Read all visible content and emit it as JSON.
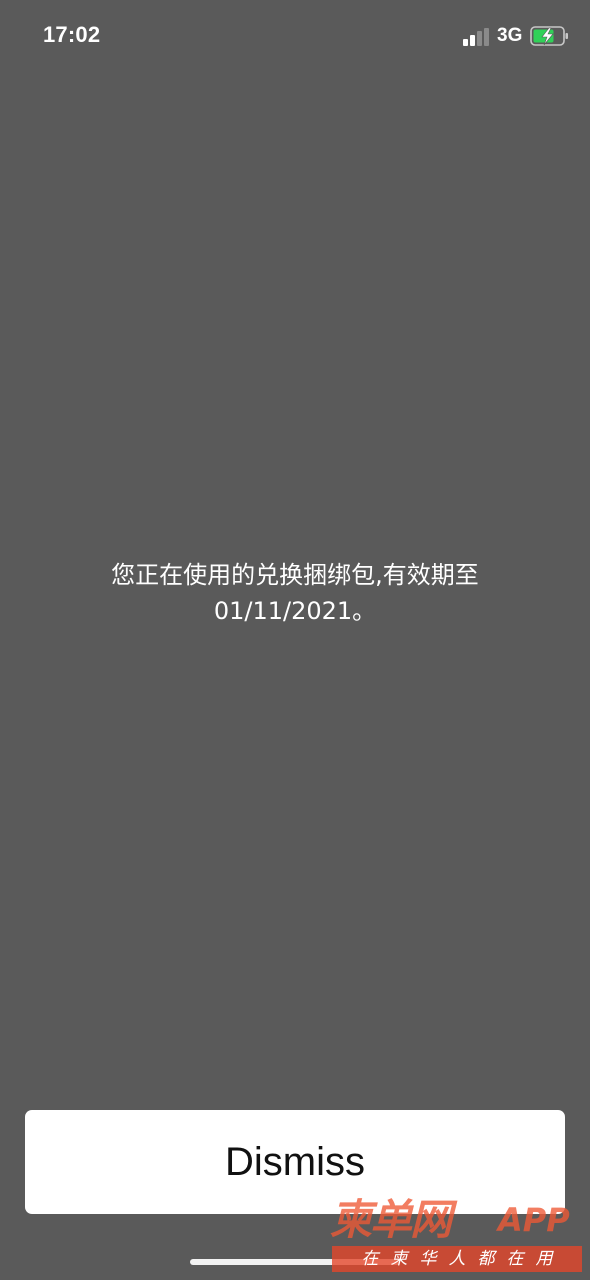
{
  "status_bar": {
    "time": "17:02",
    "network": "3G",
    "signal_icon": "signal-bars-icon",
    "battery_icon": "battery-charging-icon",
    "battery_color": "#30d158"
  },
  "dialog": {
    "message_line1": "您正在使用的兑换捆绑包,有效期至",
    "message_line2": "01/11/2021。",
    "dismiss_label": "Dismiss"
  },
  "watermark": {
    "title": "柬单网",
    "app": "APP",
    "slogan": "在柬华人都在用"
  },
  "colors": {
    "background": "#5a5a5a",
    "button_background": "#ffffff",
    "watermark_accent": "#e4462a"
  }
}
